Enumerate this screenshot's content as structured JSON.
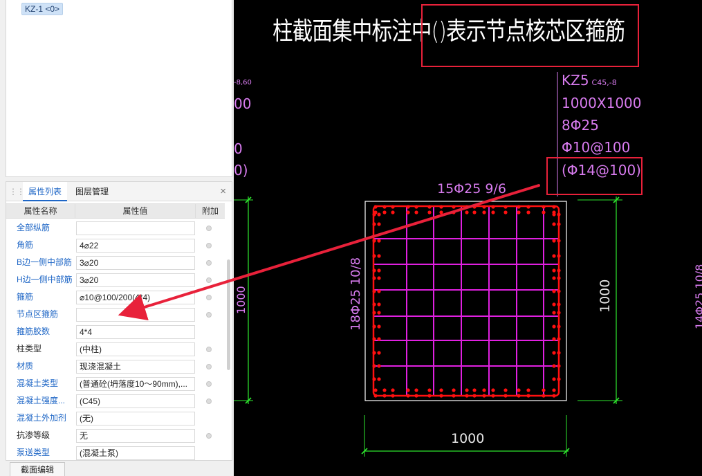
{
  "tree": {
    "node_label": "KZ-1 <0>"
  },
  "panel": {
    "tabs": [
      {
        "label": "属性列表"
      },
      {
        "label": "图层管理"
      }
    ],
    "close_label": "×",
    "columns": {
      "name": "属性名称",
      "value": "属性值",
      "extra": "附加"
    },
    "rows": [
      {
        "name": "全部纵筋",
        "value": "",
        "blue": true,
        "dot": true
      },
      {
        "name": "角筋",
        "value": "4⌀22",
        "blue": true,
        "dot": true
      },
      {
        "name": "B边一侧中部筋",
        "value": "3⌀20",
        "blue": true,
        "dot": true
      },
      {
        "name": "H边一侧中部筋",
        "value": "3⌀20",
        "blue": true,
        "dot": true
      },
      {
        "name": "箍筋",
        "value": "⌀10@100/200(4*4)",
        "blue": true,
        "dot": true
      },
      {
        "name": "节点区箍筋",
        "value": "",
        "blue": true,
        "dot": true
      },
      {
        "name": "箍筋胶数",
        "value": "4*4",
        "blue": true,
        "dot": false
      },
      {
        "name": "柱类型",
        "value": "(中柱)",
        "blue": false,
        "dot": true
      },
      {
        "name": "材质",
        "value": "现浇混凝土",
        "blue": true,
        "dot": true
      },
      {
        "name": "混凝土类型",
        "value": "(普通砼(坍落度10～90mm),...",
        "blue": true,
        "dot": true
      },
      {
        "name": "混凝土强度...",
        "value": "(C45)",
        "blue": true,
        "dot": true
      },
      {
        "name": "混凝土外加剂",
        "value": "(无)",
        "blue": true,
        "dot": false
      },
      {
        "name": "抗渗等级",
        "value": "无",
        "blue": false,
        "dot": true
      },
      {
        "name": "泵送类型",
        "value": "(混凝土泵)",
        "blue": true,
        "dot": false
      }
    ],
    "section_edit_button": "截面编辑"
  },
  "cad": {
    "caption": "柱截面集中标注中()表示节点核芯区箍筋",
    "label": {
      "name": "KZ5",
      "name_suffix": "C45,-8",
      "size": "1000X1000",
      "longitudinal": "8Φ25",
      "stirrup": "Φ10@100",
      "core_stirrup": "(Φ14@100)"
    },
    "top_rebar": "15Φ25 9/6",
    "side_rebar": "18Φ25 10/8",
    "dim_bottom": "1000",
    "dim_right": "1000",
    "dim_left": "1000",
    "right_edge_text": "14Φ25 10/8",
    "left_fragments": [
      "-8,60",
      "00",
      "0",
      "0)"
    ],
    "colors": {
      "canvas": "#000000",
      "rebar": "#ff1010",
      "stirrup": "#e020e0",
      "dimension": "#2ee82e",
      "annotation": "#d97cf0",
      "highlight": "#e8213a"
    }
  }
}
